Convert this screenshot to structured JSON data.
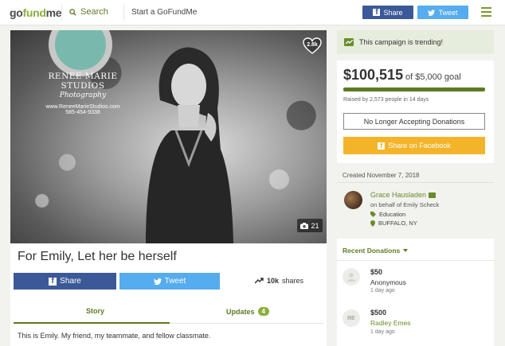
{
  "header": {
    "logo_pre": "go",
    "logo_accent": "fund",
    "logo_post": "me",
    "search_label": "Search",
    "start_label": "Start a GoFundMe",
    "share_label": "Share",
    "tweet_label": "Tweet"
  },
  "hero": {
    "studio_name": "RENEE MARIE STUDIOS",
    "studio_sub": "Photography",
    "studio_url": "www.ReneeMarieStudios.com",
    "studio_phone": "585-454-9338",
    "hearts": "2.8k",
    "photo_count": "21"
  },
  "campaign": {
    "title": "For Emily, Let her be herself",
    "share_label": "Share",
    "tweet_label": "Tweet",
    "shares_count": "10k",
    "shares_label": "shares",
    "tab_story": "Story",
    "tab_updates": "Updates",
    "updates_count": "4",
    "story_text": "This is Emily. My friend, my teammate, and fellow classmate."
  },
  "sidebar": {
    "trending": "This campaign is trending!",
    "raised": "$100,515",
    "goal": "of $5,000 goal",
    "raised_by": "Raised by 2,573 people in 14 days",
    "progress_fraction": 1.0,
    "no_longer": "No Longer Accepting Donations",
    "share_fb": "Share on Facebook",
    "created": "Created November 7, 2018",
    "organizer": "Grace Hausladen",
    "behalf": "on behalf of Emily Scheck",
    "category": "Education",
    "location": "BUFFALO, NY",
    "recent_label": "Recent Donations",
    "donations": [
      {
        "initials": "",
        "amount": "$50",
        "name": "Anonymous",
        "time": "1 day ago"
      },
      {
        "initials": "RE",
        "amount": "$500",
        "name": "Radley Emes",
        "time": "1 day ago"
      }
    ]
  },
  "colors": {
    "brand_green": "#8cae3c",
    "dark_green": "#5e7a24",
    "facebook": "#3b5998",
    "twitter": "#55acee",
    "share_orange": "#f4b429"
  },
  "icons": [
    "search-icon",
    "facebook-icon",
    "twitter-icon",
    "menu-icon",
    "heart-icon",
    "camera-icon",
    "trend-icon",
    "mail-icon",
    "tag-icon",
    "location-icon",
    "chevron-down-icon",
    "user-icon"
  ]
}
